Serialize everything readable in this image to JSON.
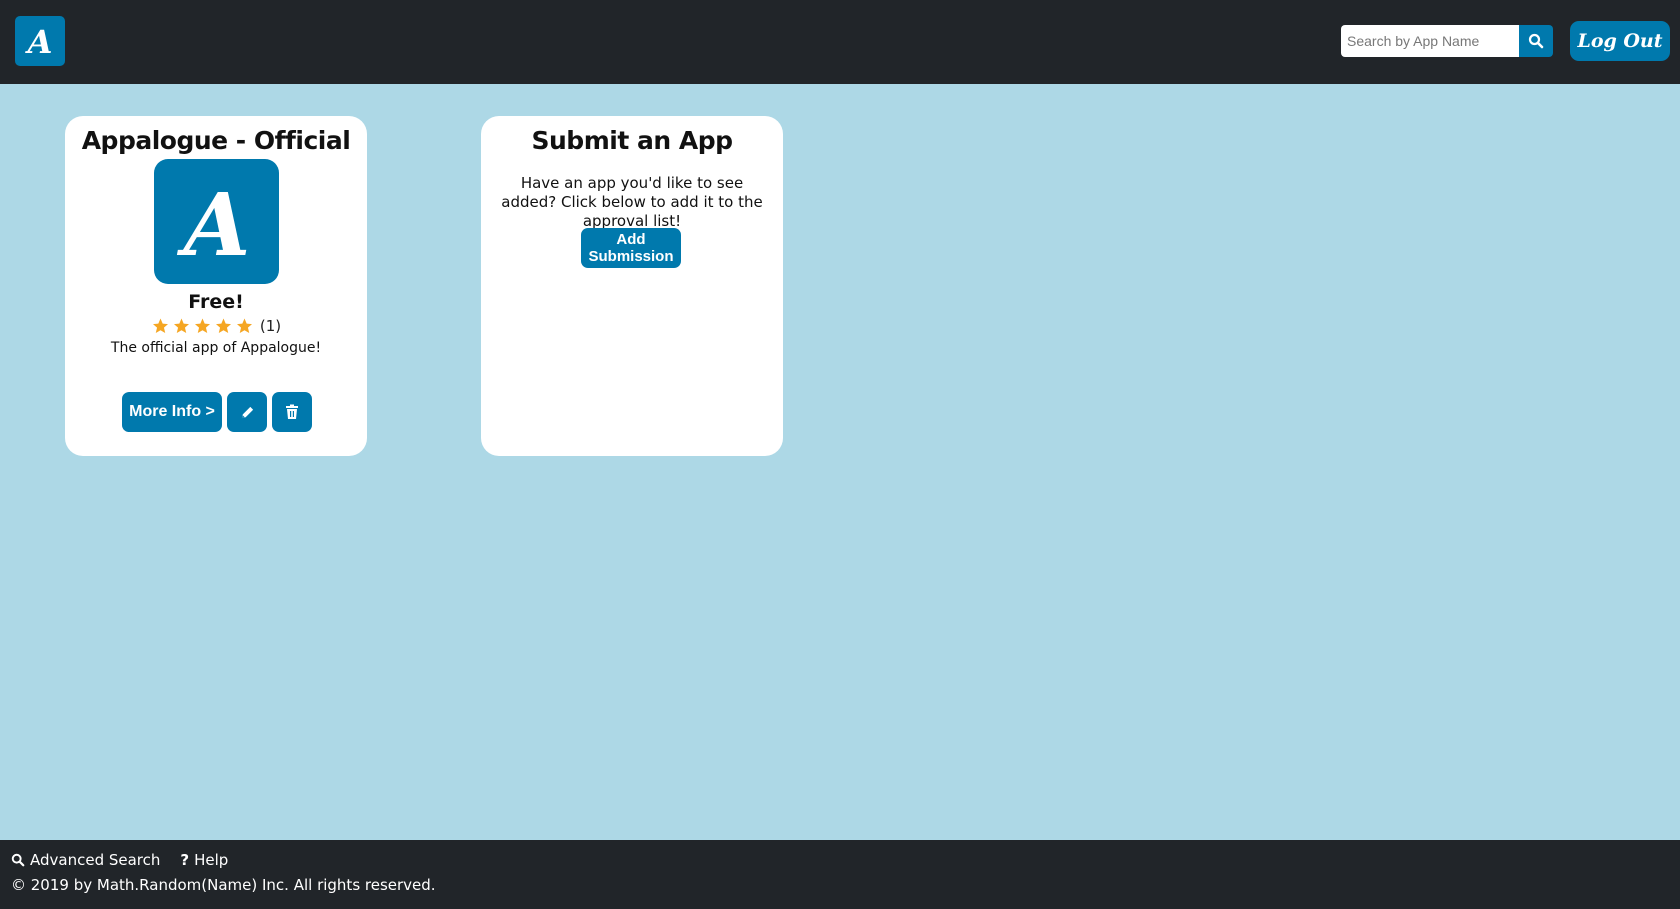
{
  "header": {
    "logo_letter": "A",
    "search_placeholder": "Search by App Name",
    "search_icon": "search-icon",
    "logout_label": "Log Out"
  },
  "cards": [
    {
      "title": "Appalogue - Official App",
      "icon_letter": "A",
      "price": "Free!",
      "rating_stars": 5,
      "rating_count": "(1)",
      "description": "The official app of Appalogue!",
      "more_info_label": "More Info >",
      "edit_icon": "pencil-icon",
      "delete_icon": "trash-icon"
    },
    {
      "title": "Submit an App",
      "text": "Have an app you'd like to see added? Click below to add it to the approval list!",
      "button_label_line1": "Add",
      "button_label_line2": "Submission"
    }
  ],
  "footer": {
    "links": [
      {
        "icon": "search-icon",
        "label": "Advanced Search"
      },
      {
        "icon": "question-icon",
        "label": "Help"
      }
    ],
    "copyright": "© 2019 by Math.Random(Name) Inc. All rights reserved."
  },
  "colors": {
    "accent": "#0079ad",
    "background": "#add8e6",
    "bar": "#212529",
    "star": "#f5a623"
  }
}
